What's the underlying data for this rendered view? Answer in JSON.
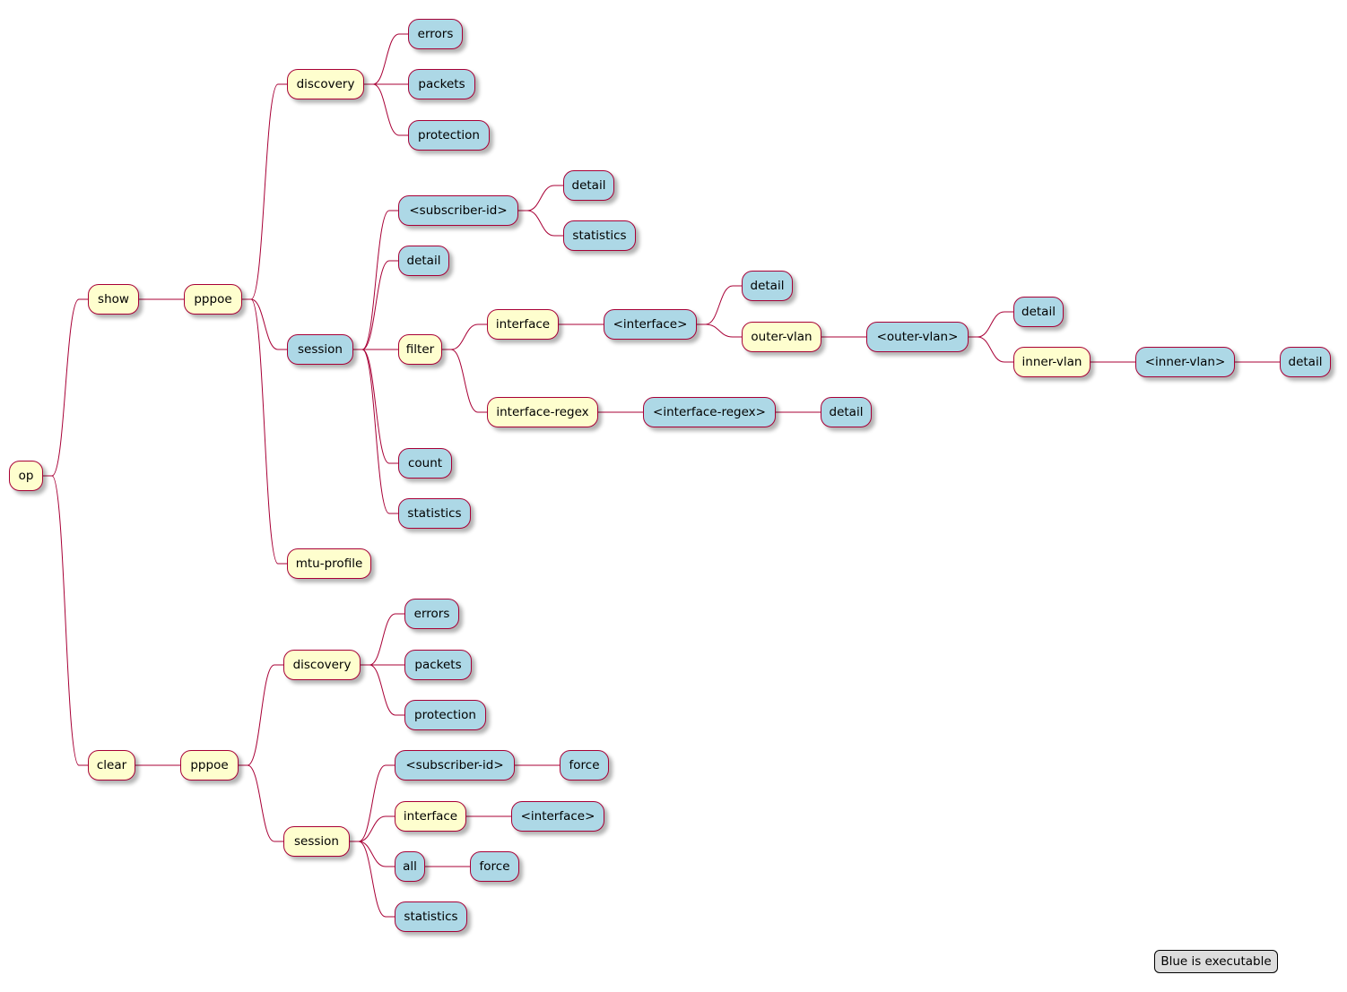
{
  "colors": {
    "command": "#FEFECE",
    "executable": "#ADD8E6",
    "border": "#A80036",
    "legend": "#DDDDDD"
  },
  "legend": {
    "text": "Blue is executable"
  },
  "nodes": [
    {
      "label": "op",
      "parent": -1,
      "executable": false
    },
    {
      "label": "show",
      "parent": 0,
      "executable": false
    },
    {
      "label": "clear",
      "parent": 0,
      "executable": false
    },
    {
      "label": "pppoe",
      "parent": 1,
      "executable": false
    },
    {
      "label": "pppoe",
      "parent": 2,
      "executable": false
    },
    {
      "label": "discovery",
      "parent": 3,
      "executable": false
    },
    {
      "label": "session",
      "parent": 3,
      "executable": true
    },
    {
      "label": "mtu-profile",
      "parent": 3,
      "executable": false
    },
    {
      "label": "errors",
      "parent": 5,
      "executable": true
    },
    {
      "label": "packets",
      "parent": 5,
      "executable": true
    },
    {
      "label": "protection",
      "parent": 5,
      "executable": true
    },
    {
      "label": "<subscriber-id>",
      "parent": 6,
      "executable": true
    },
    {
      "label": "detail",
      "parent": 6,
      "executable": true
    },
    {
      "label": "filter",
      "parent": 6,
      "executable": false
    },
    {
      "label": "count",
      "parent": 6,
      "executable": true
    },
    {
      "label": "statistics",
      "parent": 6,
      "executable": true
    },
    {
      "label": "detail",
      "parent": 11,
      "executable": true
    },
    {
      "label": "statistics",
      "parent": 11,
      "executable": true
    },
    {
      "label": "interface",
      "parent": 13,
      "executable": false
    },
    {
      "label": "interface-regex",
      "parent": 13,
      "executable": false
    },
    {
      "label": "<interface>",
      "parent": 18,
      "executable": true
    },
    {
      "label": "detail",
      "parent": 20,
      "executable": true
    },
    {
      "label": "outer-vlan",
      "parent": 20,
      "executable": false
    },
    {
      "label": "<outer-vlan>",
      "parent": 22,
      "executable": true
    },
    {
      "label": "detail",
      "parent": 23,
      "executable": true
    },
    {
      "label": "inner-vlan",
      "parent": 23,
      "executable": false
    },
    {
      "label": "<inner-vlan>",
      "parent": 25,
      "executable": true
    },
    {
      "label": "detail",
      "parent": 26,
      "executable": true
    },
    {
      "label": "<interface-regex>",
      "parent": 19,
      "executable": true
    },
    {
      "label": "detail",
      "parent": 28,
      "executable": true
    },
    {
      "label": "discovery",
      "parent": 4,
      "executable": false
    },
    {
      "label": "errors",
      "parent": 30,
      "executable": true
    },
    {
      "label": "packets",
      "parent": 30,
      "executable": true
    },
    {
      "label": "protection",
      "parent": 30,
      "executable": true
    },
    {
      "label": "session",
      "parent": 4,
      "executable": false
    },
    {
      "label": "<subscriber-id>",
      "parent": 34,
      "executable": true
    },
    {
      "label": "force",
      "parent": 35,
      "executable": true
    },
    {
      "label": "interface",
      "parent": 34,
      "executable": false
    },
    {
      "label": "<interface>",
      "parent": 37,
      "executable": true
    },
    {
      "label": "all",
      "parent": 34,
      "executable": true
    },
    {
      "label": "force",
      "parent": 39,
      "executable": true
    },
    {
      "label": "statistics",
      "parent": 34,
      "executable": true
    }
  ]
}
